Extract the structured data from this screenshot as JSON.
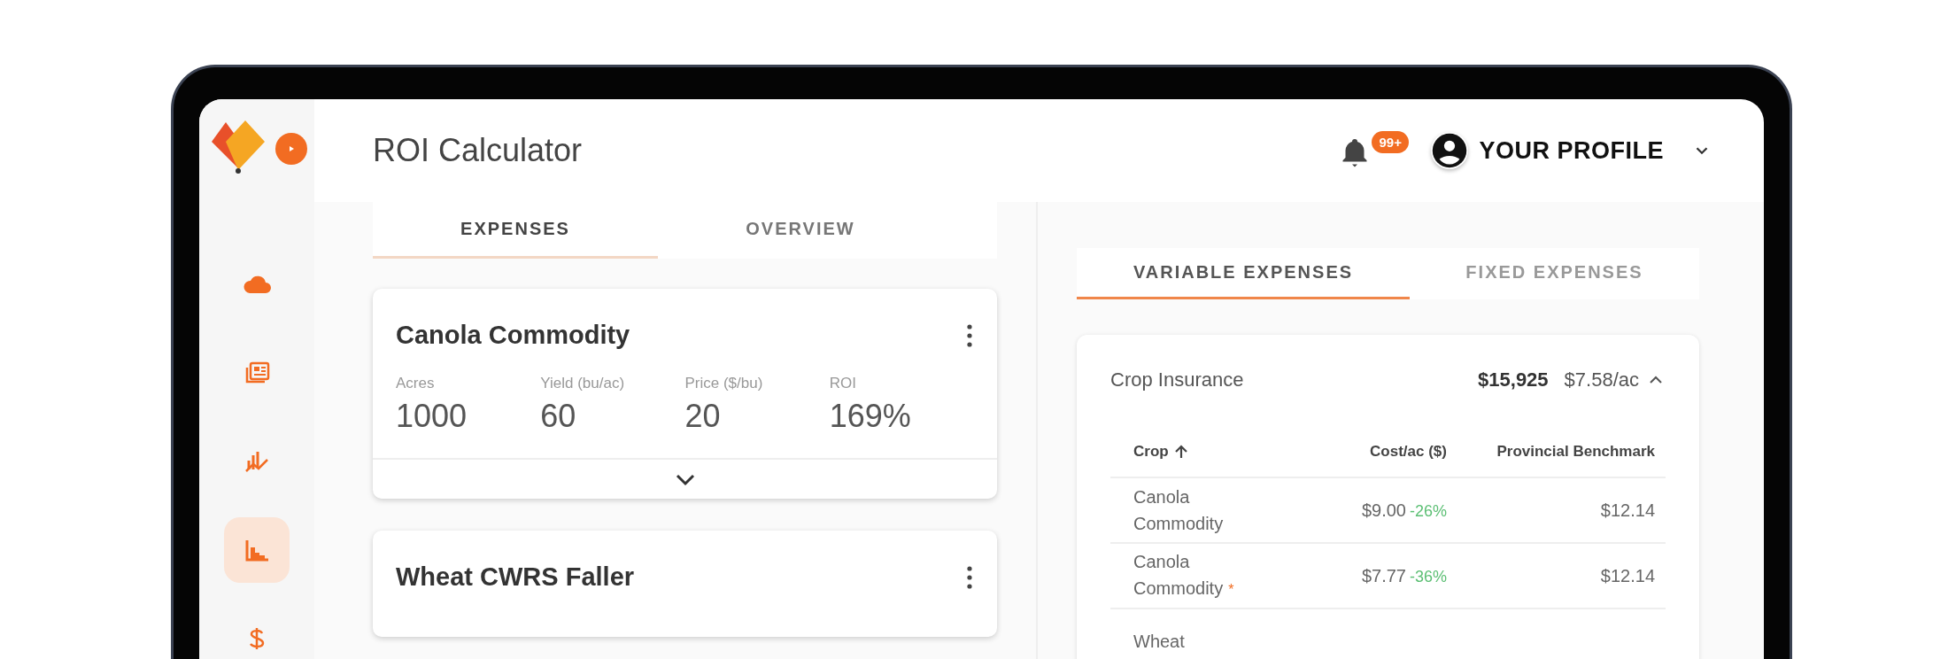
{
  "app": {
    "title": "ROI Calculator"
  },
  "sidebar": {
    "items": [
      {
        "kind": "weather",
        "selected": false
      },
      {
        "kind": "news",
        "selected": false
      },
      {
        "kind": "markets",
        "selected": false
      },
      {
        "kind": "roi",
        "selected": true
      },
      {
        "kind": "finance",
        "selected": false
      }
    ]
  },
  "notifications": {
    "badge": "99+"
  },
  "profile": {
    "label": "YOUR PROFILE"
  },
  "tabs": [
    {
      "label": "EXPENSES",
      "selected": true
    },
    {
      "label": "OVERVIEW",
      "selected": false
    }
  ],
  "crops": [
    {
      "name": "Canola Commodity",
      "expanded": false,
      "fields": [
        {
          "label": "Acres",
          "value": "1000"
        },
        {
          "label": "Yield (bu/ac)",
          "value": "60"
        },
        {
          "label": "Price ($/bu)",
          "value": "20"
        },
        {
          "label": "ROI",
          "value": "169%"
        }
      ]
    },
    {
      "name": "Wheat CWRS Faller"
    }
  ],
  "expense_tabs": [
    {
      "label": "VARIABLE EXPENSES",
      "selected": true
    },
    {
      "label": "FIXED EXPENSES",
      "selected": false
    }
  ],
  "expense": {
    "name": "Crop Insurance",
    "total": "$15,925",
    "per_acre": "$7.58/ac",
    "expanded": true,
    "table": {
      "columns": [
        {
          "label": "Crop",
          "sorted": true
        },
        {
          "label": "Cost/ac ($)",
          "sorted": false
        },
        {
          "label": "Provincial Benchmark",
          "sorted": false
        }
      ],
      "rows": [
        {
          "crop": "Canola Commodity",
          "cost": "$9.00",
          "change": "-26%",
          "benchmark": "$12.14"
        },
        {
          "crop": "Canola Commodity",
          "note_mark": "*",
          "cost": "$7.77",
          "change": "-36%",
          "benchmark": "$12.14"
        },
        {
          "crop": "Wheat"
        }
      ]
    }
  }
}
